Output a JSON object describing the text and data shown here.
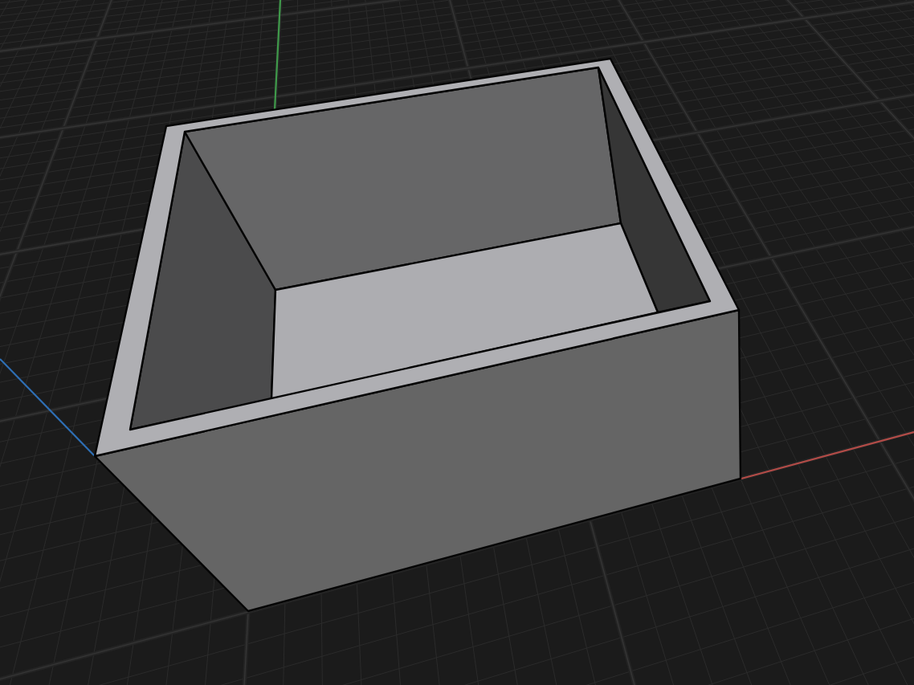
{
  "viewport": {
    "axes": [
      {
        "color": "#b24b47"
      },
      {
        "color": "#3f9a4a"
      },
      {
        "color": "#2e6fb5"
      }
    ]
  }
}
